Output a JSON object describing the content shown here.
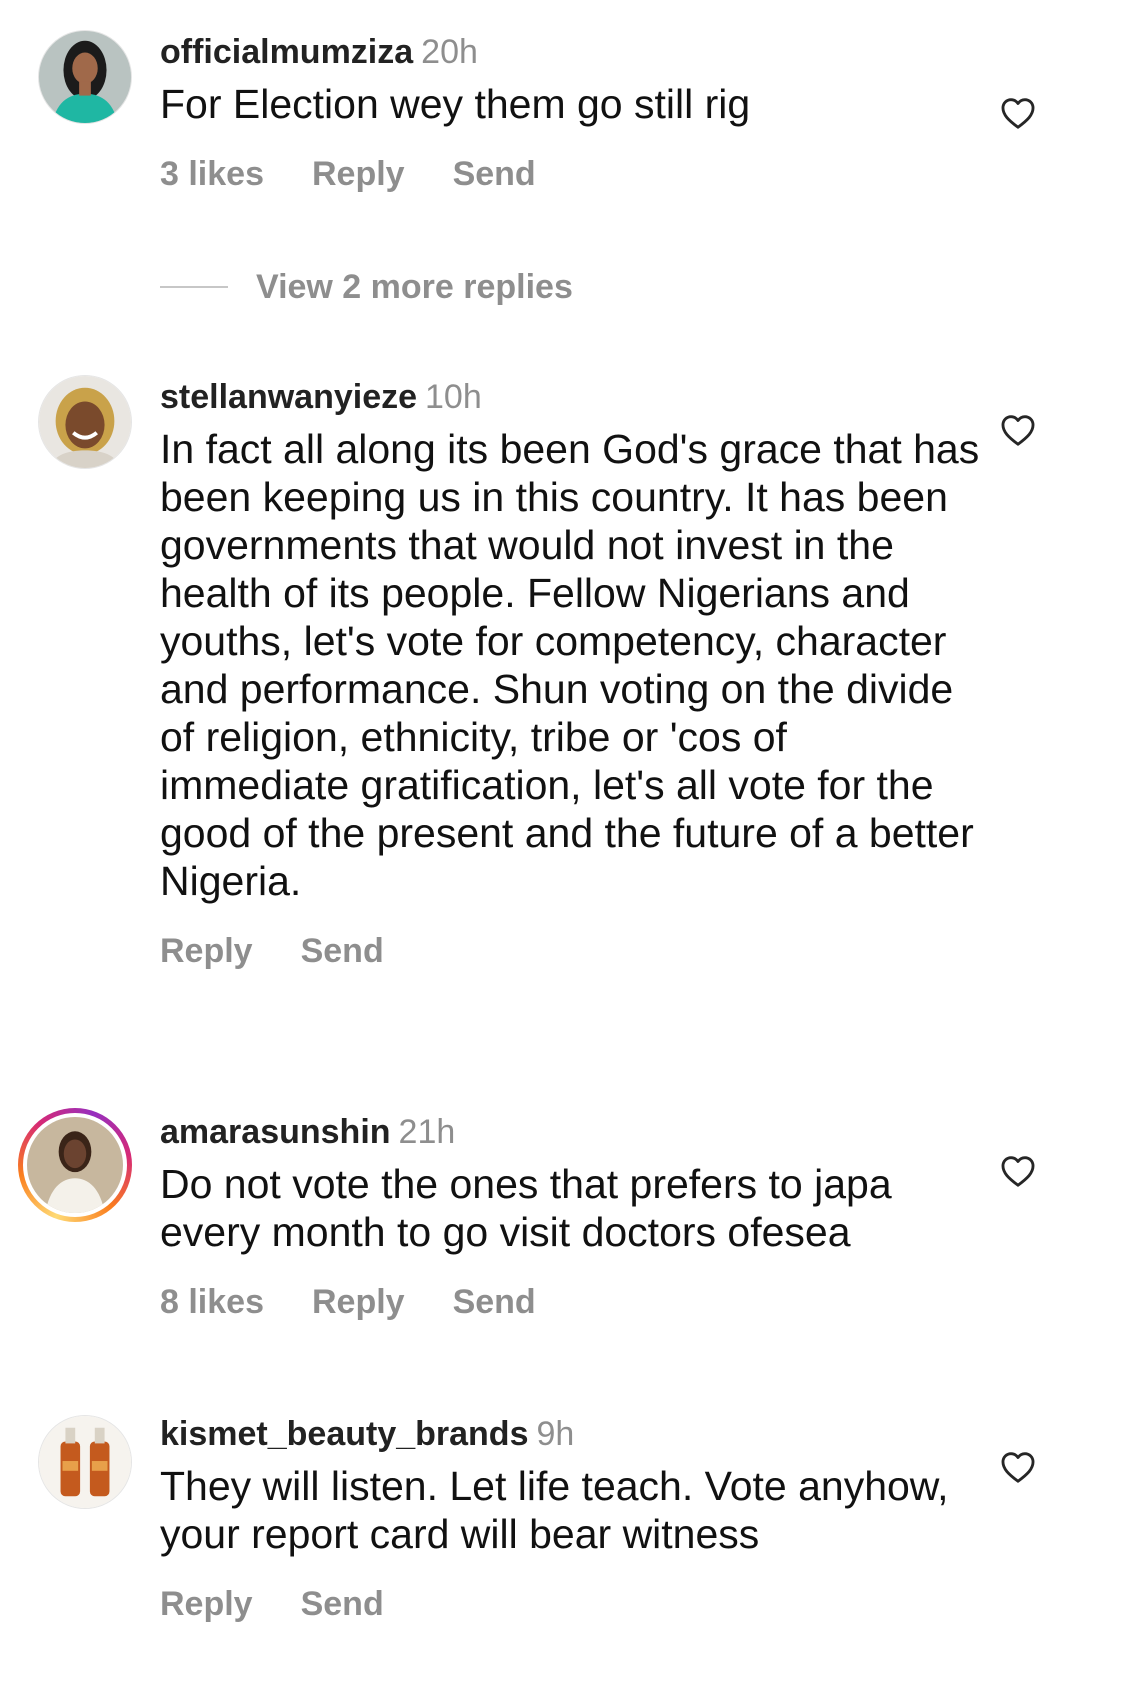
{
  "comments": [
    {
      "username": "officialmumziza",
      "time": "20h",
      "text": "For Election wey them go still rig",
      "likes": "3 likes",
      "reply": "Reply",
      "send": "Send",
      "avatar_icon": "profile-photo-woman-teal",
      "view_more": "View 2 more replies"
    },
    {
      "username": "stellanwanyieze",
      "time": "10h",
      "text": "In fact all along its been God's grace that has been keeping us in this country. It has been governments that would  not invest in the health of its people. Fellow Nigerians and youths, let's vote for competency, character and performance. Shun voting on the divide of religion, ethnicity, tribe or 'cos of immediate gratification, let's all vote for the good of the present and the future of a better Nigeria.",
      "reply": "Reply",
      "send": "Send",
      "avatar_icon": "profile-photo-smiling-woman"
    },
    {
      "username": "amarasunshin",
      "time": "21h",
      "text": "Do not vote the ones that prefers to japa every month to go visit doctors ofesea",
      "likes": "8 likes",
      "reply": "Reply",
      "send": "Send",
      "avatar_icon": "profile-photo-woman-white-outfit-story-ring"
    },
    {
      "username": "kismet_beauty_brands",
      "time": "9h",
      "text": "They will listen. Let life teach. Vote anyhow, your report card will bear witness",
      "reply": "Reply",
      "send": "Send",
      "avatar_icon": "profile-photo-product-bottles"
    }
  ],
  "colors": {
    "secondary_text": "#8e8e8e",
    "primary_text": "#111111",
    "story_ring": [
      "#feda75",
      "#fa7e1e",
      "#d62976",
      "#962fbf"
    ]
  }
}
